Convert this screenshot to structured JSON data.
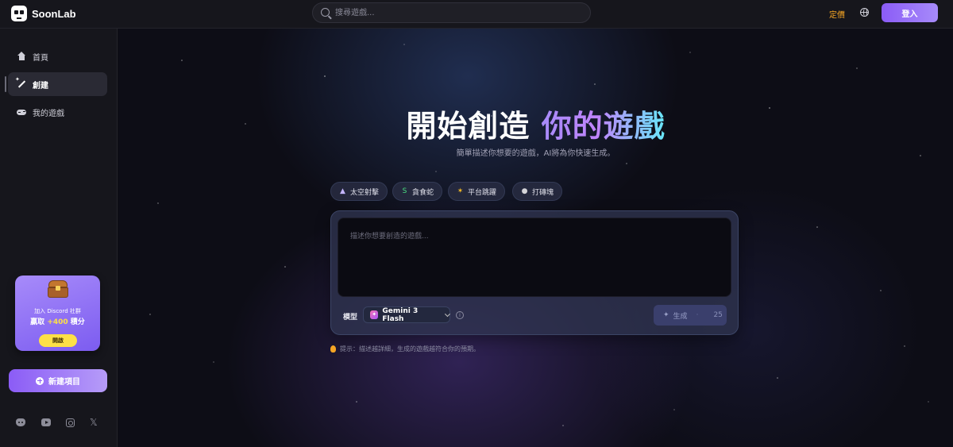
{
  "brand": {
    "name": "SoonLab"
  },
  "search": {
    "placeholder": "搜尋遊戲..."
  },
  "header": {
    "pricing_label": "定價",
    "login_label": "登入"
  },
  "sidebar": {
    "items": [
      {
        "label": "首頁",
        "icon": "home-icon"
      },
      {
        "label": "創建",
        "icon": "wand-icon"
      },
      {
        "label": "我的遊戲",
        "icon": "gamepad-icon"
      }
    ],
    "promo": {
      "line1": "加入 Discord 社群",
      "line2_prefix": "贏取",
      "line2_points": "+400",
      "line2_suffix": "積分",
      "button": "開啟"
    },
    "new_project_label": "新建項目",
    "socials": [
      "discord-icon",
      "youtube-icon",
      "instagram-icon",
      "x-icon"
    ]
  },
  "hero": {
    "title_white": "開始創造",
    "title_gradient": "你的遊戲",
    "subtitle": "簡單描述你想要的遊戲，AI將為你快速生成。"
  },
  "chips": [
    {
      "label": "太空射擊",
      "icon": "rocket-icon"
    },
    {
      "label": "貪食蛇",
      "icon": "snake-icon"
    },
    {
      "label": "平台跳躍",
      "icon": "runner-icon"
    },
    {
      "label": "打磚塊",
      "icon": "ball-icon"
    }
  ],
  "composer": {
    "placeholder": "描述你想要創造的遊戲...",
    "model_label": "模型",
    "model_value": "Gemini 3 Flash",
    "generate_label": "生成",
    "generate_cost": "25"
  },
  "hint": "提示：描述越詳細，生成的遊戲越符合你的預期。",
  "colors": {
    "accent": "#8b5cf6",
    "pricing": "#f5a524",
    "promo_gold": "#fde047"
  }
}
